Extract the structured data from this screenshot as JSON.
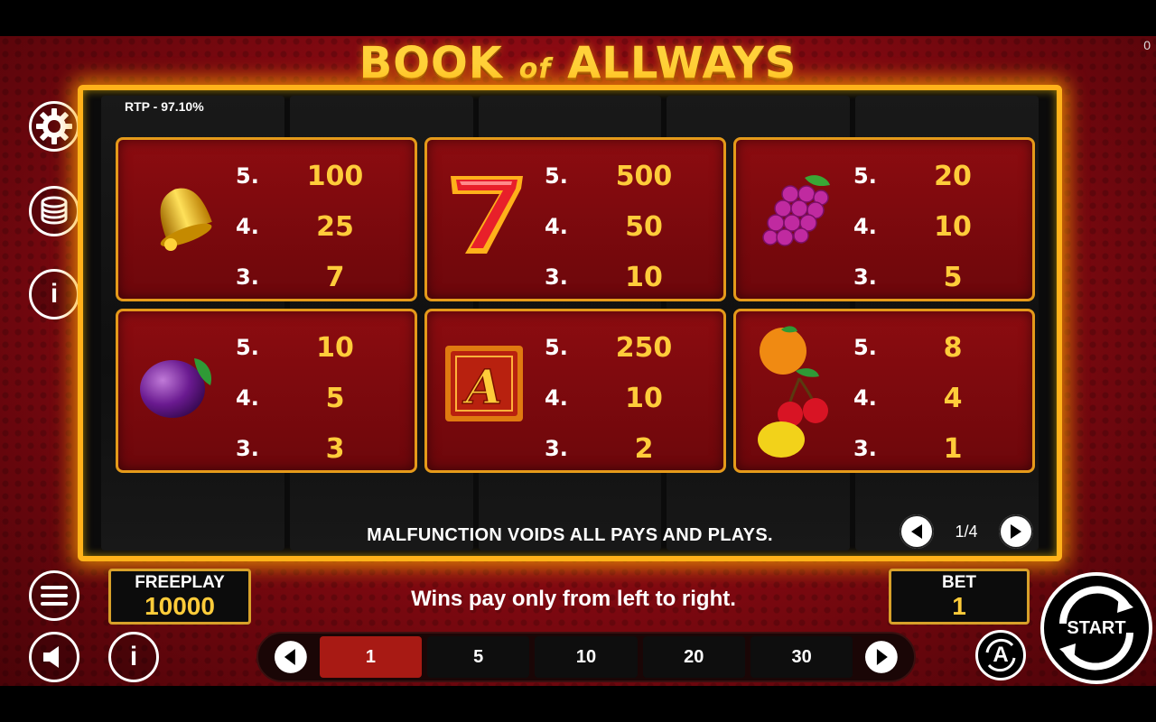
{
  "title": {
    "main": "BOOK",
    "of": "of",
    "brand": "ALLWAYS"
  },
  "corner_value": "0",
  "rtp": "RTP - 97.10%",
  "paytable": [
    {
      "symbol": "bell-icon",
      "rows": [
        [
          "5.",
          "100"
        ],
        [
          "4.",
          "25"
        ],
        [
          "3.",
          "7"
        ]
      ]
    },
    {
      "symbol": "seven-icon",
      "rows": [
        [
          "5.",
          "500"
        ],
        [
          "4.",
          "50"
        ],
        [
          "3.",
          "10"
        ]
      ]
    },
    {
      "symbol": "grapes-icon",
      "rows": [
        [
          "5.",
          "20"
        ],
        [
          "4.",
          "10"
        ],
        [
          "3.",
          "5"
        ]
      ]
    },
    {
      "symbol": "plum-icon",
      "rows": [
        [
          "5.",
          "10"
        ],
        [
          "4.",
          "5"
        ],
        [
          "3.",
          "3"
        ]
      ]
    },
    {
      "symbol": "book-a-icon",
      "rows": [
        [
          "5.",
          "250"
        ],
        [
          "4.",
          "10"
        ],
        [
          "3.",
          "2"
        ]
      ]
    },
    {
      "symbol": "fruit-mix-icon",
      "rows": [
        [
          "5.",
          "8"
        ],
        [
          "4.",
          "4"
        ],
        [
          "3.",
          "1"
        ]
      ]
    }
  ],
  "malfunction_text": "MALFUNCTION VOIDS ALL PAYS AND PLAYS.",
  "pager": {
    "indicator": "1/4"
  },
  "freeplay": {
    "label": "FREEPLAY",
    "value": "10000"
  },
  "bet": {
    "label": "BET",
    "value": "1"
  },
  "wins_note": "Wins pay only from left to right.",
  "bet_options": [
    "1",
    "5",
    "10",
    "20",
    "30"
  ],
  "selected_bet": "1",
  "start_label": "START",
  "auto_label": "A",
  "colors": {
    "gold": "#ffcc3a",
    "frame": "#ffb21a",
    "card": "#8c0c10",
    "active_bet": "#a81a14"
  }
}
